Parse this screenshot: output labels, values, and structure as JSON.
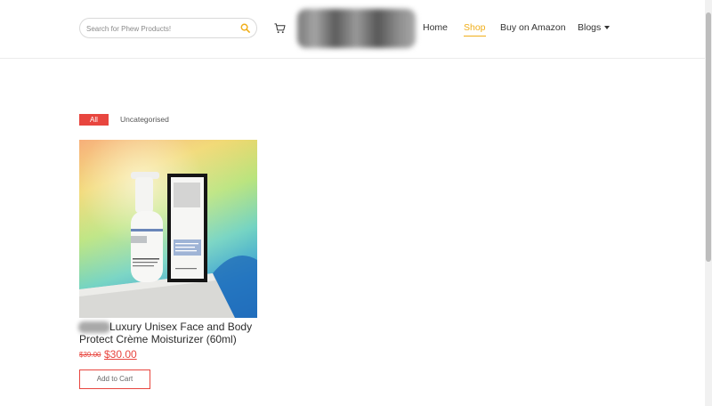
{
  "header": {
    "search": {
      "placeholder": "Search for Phew Products!",
      "value": ""
    },
    "nav": [
      {
        "label": "Home",
        "active": false
      },
      {
        "label": "Shop",
        "active": true
      },
      {
        "label": "Buy on Amazon",
        "active": false
      },
      {
        "label": "Blogs",
        "has_dropdown": true
      }
    ]
  },
  "filters": [
    {
      "label": "All",
      "active": true
    },
    {
      "label": "Uncategorised",
      "active": false
    }
  ],
  "products": [
    {
      "title_line1": "Luxury Unisex Face and Body",
      "title_line2": "Protect Crème Moisturizer (60ml)",
      "old_price": "$39.00",
      "price": "$30.00",
      "button_label": "Add to Cart"
    }
  ],
  "colors": {
    "accent": "#f0ae1a",
    "sale": "#e8463f"
  },
  "icons": [
    "search-icon",
    "cart-icon",
    "chevron-down-icon"
  ]
}
